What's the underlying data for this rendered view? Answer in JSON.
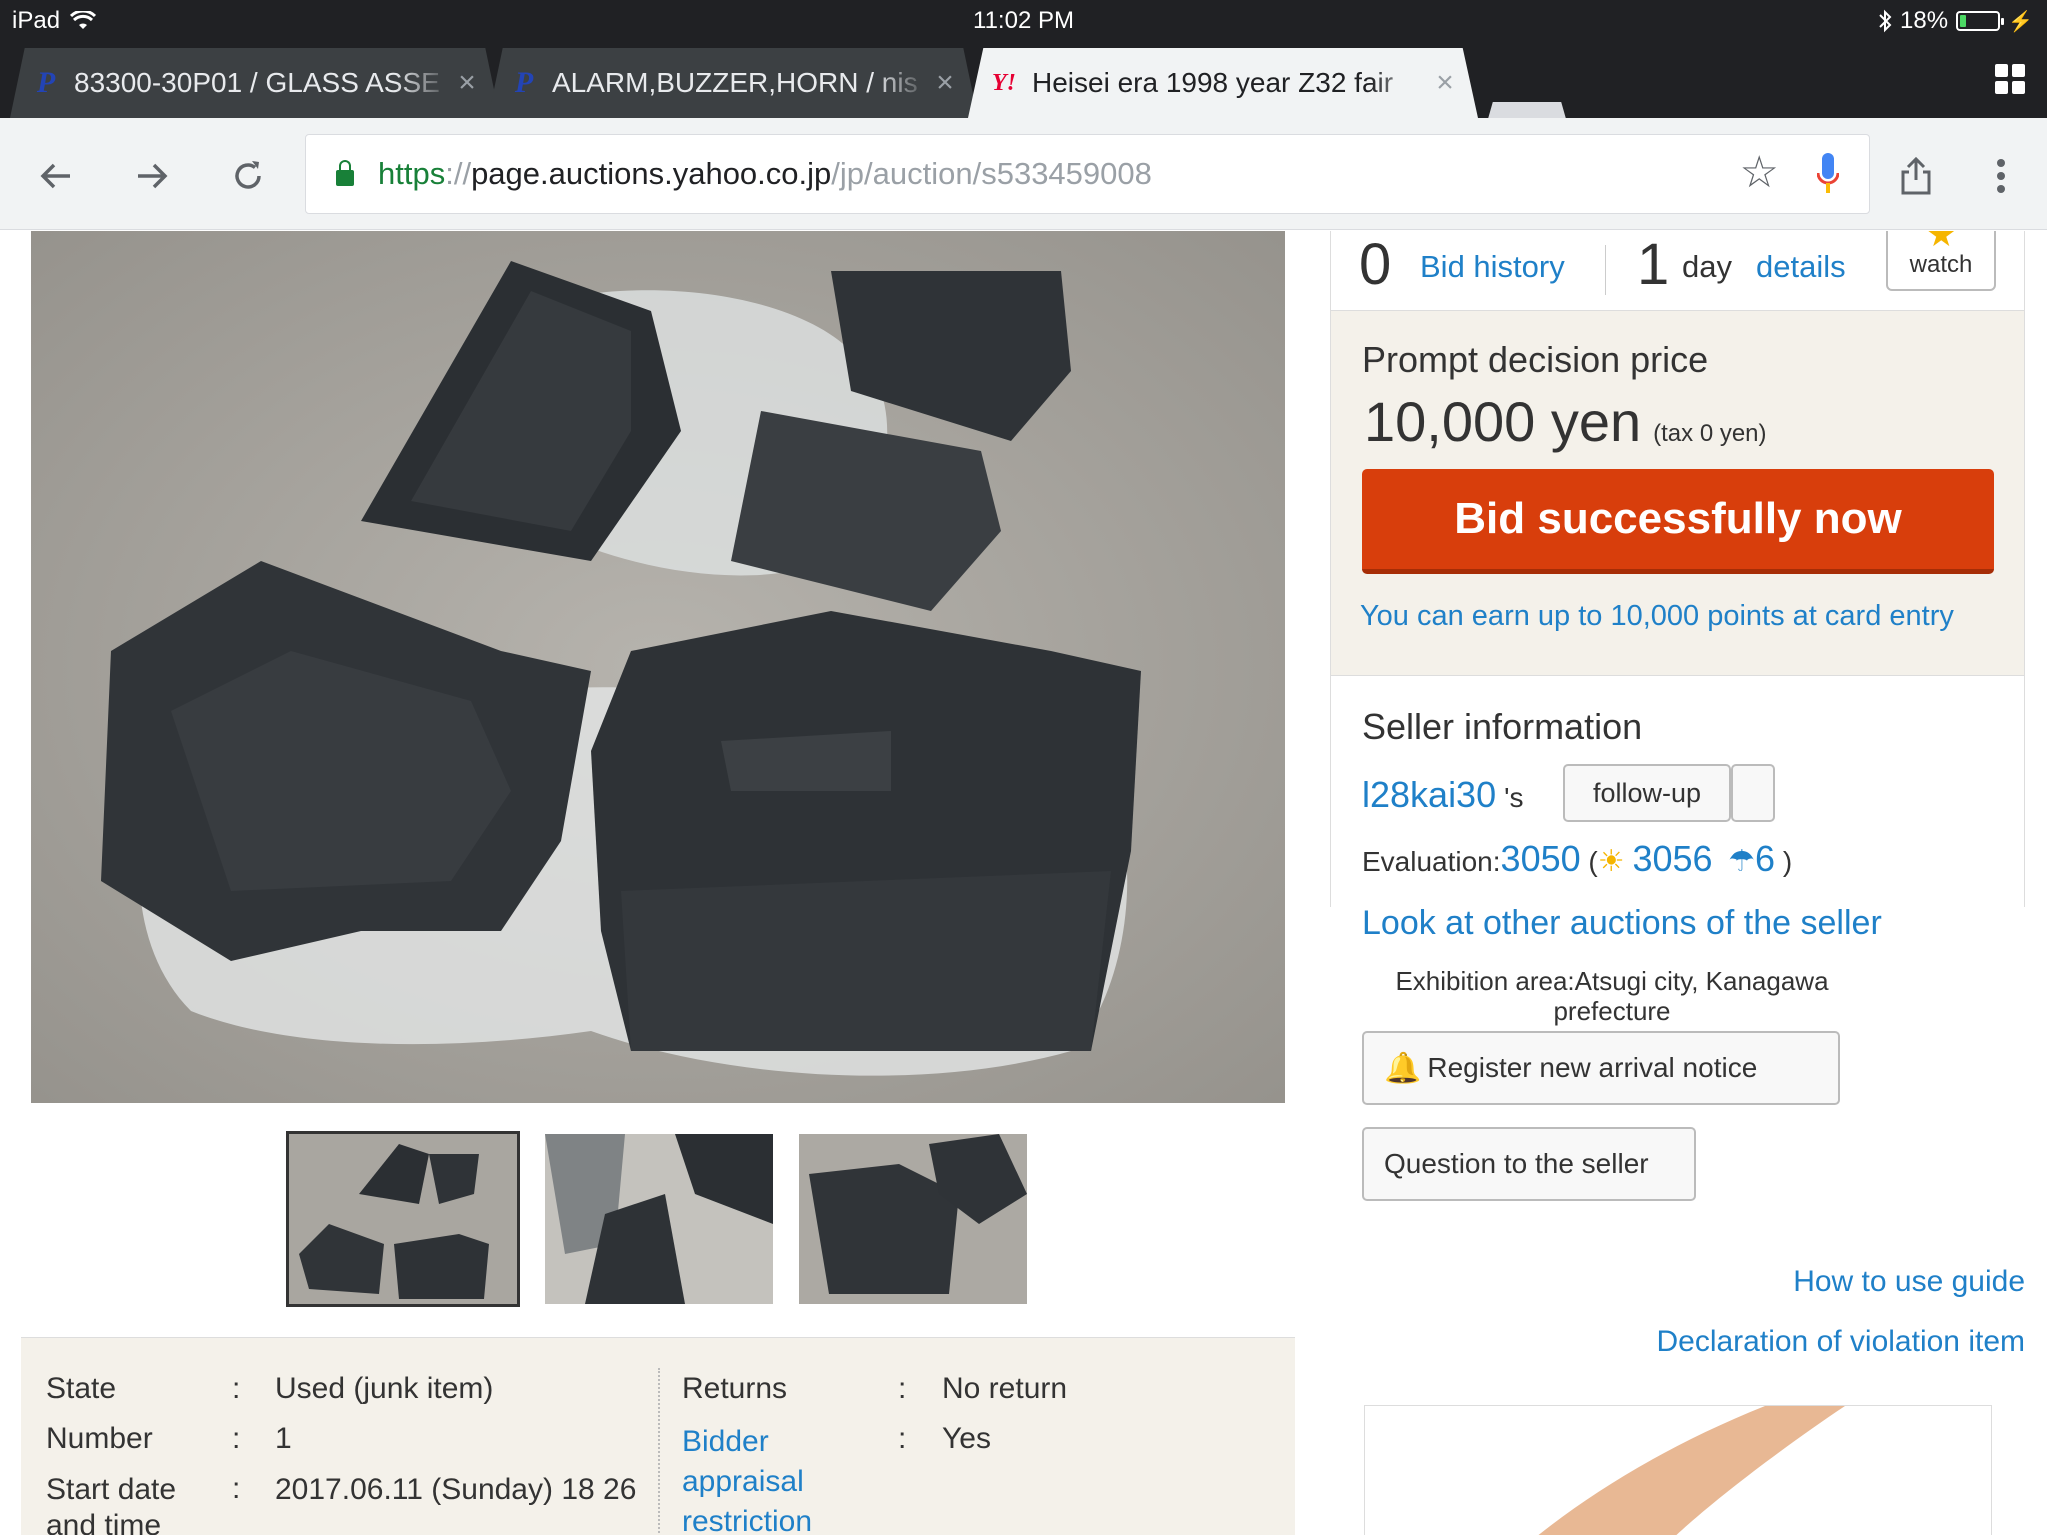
{
  "status": {
    "device": "iPad",
    "time": "11:02 PM",
    "battery": "18%"
  },
  "tabs": [
    {
      "title": "83300-30P01 / GLASS ASSE",
      "favicon": "P",
      "active": false
    },
    {
      "title": "ALARM,BUZZER,HORN / nis",
      "favicon": "P",
      "active": false
    },
    {
      "title": "Heisei era 1998 year Z32 fair",
      "favicon": "Y!",
      "active": true
    }
  ],
  "omnibox": {
    "scheme": "https",
    "sep": "://",
    "host": "page.auctions.yahoo.co.jp",
    "path": "/jp/auction/s533459008"
  },
  "auction": {
    "bid_count": "0",
    "bid_history": "Bid history",
    "days_left": "1",
    "day_label": "day",
    "details": "details",
    "watch": "watch",
    "prompt_label": "Prompt decision price",
    "prompt_price": "10,000 yen",
    "prompt_tax": "(tax 0 yen)",
    "bid_now": "Bid successfully now",
    "earn_points": "You can earn up to 10,000 points at card entry"
  },
  "seller": {
    "title": "Seller information",
    "name": "l28kai30",
    "name_suffix": "'s",
    "follow": "follow-up",
    "eval_label": "Evaluation:",
    "eval_total": "3050",
    "eval_open": "(",
    "eval_good": "3056",
    "eval_bad": "6",
    "eval_close": ")",
    "other_auctions": "Look at other auctions of the seller",
    "area": "Exhibition area:Atsugi city, Kanagawa prefecture",
    "register_notice": "Register new arrival notice",
    "question": "Question to the seller"
  },
  "links": {
    "guide": "How to use guide",
    "violation": "Declaration of violation item"
  },
  "item_details": {
    "left": [
      {
        "label": "State",
        "sep": ":",
        "value": "Used (junk item)"
      },
      {
        "label": "Number",
        "sep": ":",
        "value": "1"
      },
      {
        "label": "Start date and time",
        "sep": ":",
        "value": "2017.06.11 (Sunday) 18 26"
      }
    ],
    "right": [
      {
        "label": "Returns",
        "sep": ":",
        "value": "No return"
      },
      {
        "label": "Bidder appraisal restriction",
        "sep": ":",
        "value": "Yes"
      }
    ]
  },
  "colors": {
    "accent_link": "#1f80c8",
    "bid_button": "#d83e0c",
    "panel_bg": "#f4f1ea"
  },
  "icons": [
    "wifi-icon",
    "bluetooth-icon",
    "battery-icon",
    "back-icon",
    "forward-icon",
    "reload-icon",
    "lock-icon",
    "star-icon",
    "mic-icon",
    "share-icon",
    "menu-icon",
    "tab-switcher-icon",
    "bell-icon",
    "sun-icon",
    "umbrella-icon"
  ]
}
